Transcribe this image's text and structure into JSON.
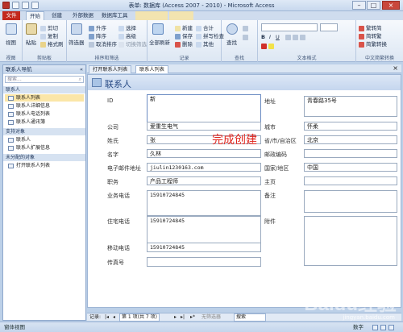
{
  "window": {
    "title": "表单: 数据库 (Access 2007 - 2010) - Microsoft Access"
  },
  "ribbon_tabs": [
    "文件",
    "开始",
    "创建",
    "外部数据",
    "数据库工具"
  ],
  "ribbon": {
    "views": {
      "view": "视图",
      "group": "视图"
    },
    "clipboard": {
      "paste": "粘贴",
      "cut": "剪切",
      "copy": "复制",
      "format_painter": "格式刷",
      "group": "剪贴板"
    },
    "sort_filter": {
      "filter": "筛选器",
      "ascending": "升序",
      "descending": "降序",
      "remove_sort": "取消排序",
      "selection": "选择",
      "advanced": "高级",
      "toggle_filter": "切换筛选",
      "group": "排序和筛选"
    },
    "records": {
      "refresh_all": "全部刷新",
      "new": "新建",
      "save": "保存",
      "delete": "删除",
      "totals": "合计",
      "spelling": "拼写检查",
      "more": "其他",
      "group": "记录"
    },
    "find": {
      "find": "查找",
      "group": "查找"
    },
    "text_format": {
      "font_name": "",
      "font_size": "",
      "group": "文本格式"
    },
    "chinese": {
      "trad_to_simp": "繁转简",
      "simp_to_trad": "简转繁",
      "convert": "简繁转换",
      "group": "中文简繁转换"
    }
  },
  "nav": {
    "header": "联系人导航",
    "search_placeholder": "搜索...",
    "groups": [
      {
        "name": "联系人",
        "items": [
          "联系人列表",
          "联系人详细信息",
          "联系人电话列表",
          "联系人通讯簿"
        ]
      },
      {
        "name": "支持对象",
        "items": [
          "联系人",
          "联系人扩展信息"
        ]
      },
      {
        "name": "未分配的对象",
        "items": [
          "打开联系人列表"
        ]
      }
    ]
  },
  "doc_tabs": [
    "打开联系人列表",
    "联系人列表"
  ],
  "form": {
    "title": "联系人",
    "annotation": "完成创建",
    "left_fields": [
      {
        "label": "ID",
        "value": "新"
      },
      {
        "label": "公司",
        "value": "爱重生电气"
      },
      {
        "label": "姓氏",
        "value": "张"
      },
      {
        "label": "名字",
        "value": "久林"
      },
      {
        "label": "电子邮件地址",
        "value": "jiulin1230163.com"
      },
      {
        "label": "职务",
        "value": "产品工程师"
      },
      {
        "label": "业务电话",
        "value": "15910724845"
      },
      {
        "label": "住宅电话",
        "value": "15910724845"
      },
      {
        "label": "移动电话",
        "value": "15910724845"
      },
      {
        "label": "传真号",
        "value": ""
      }
    ],
    "right_fields": [
      {
        "label": "地址",
        "value": "青春路35号"
      },
      {
        "label": "城市",
        "value": "怀柔"
      },
      {
        "label": "省/市/自治区",
        "value": "北京"
      },
      {
        "label": "邮政编码",
        "value": ""
      },
      {
        "label": "国家/地区",
        "value": "中国"
      },
      {
        "label": "主页",
        "value": ""
      },
      {
        "label": "备注",
        "value": ""
      },
      {
        "label": "附件",
        "value": ""
      }
    ]
  },
  "record_nav": {
    "prefix": "记录:",
    "position": "第 1 项(共 7 项)",
    "filter": "无筛选器",
    "search": "搜索"
  },
  "status": {
    "view": "窗体视图",
    "numlock": "数字"
  },
  "watermark": {
    "text": "Baidu经验",
    "sub": "jingyan.baidu.com"
  }
}
